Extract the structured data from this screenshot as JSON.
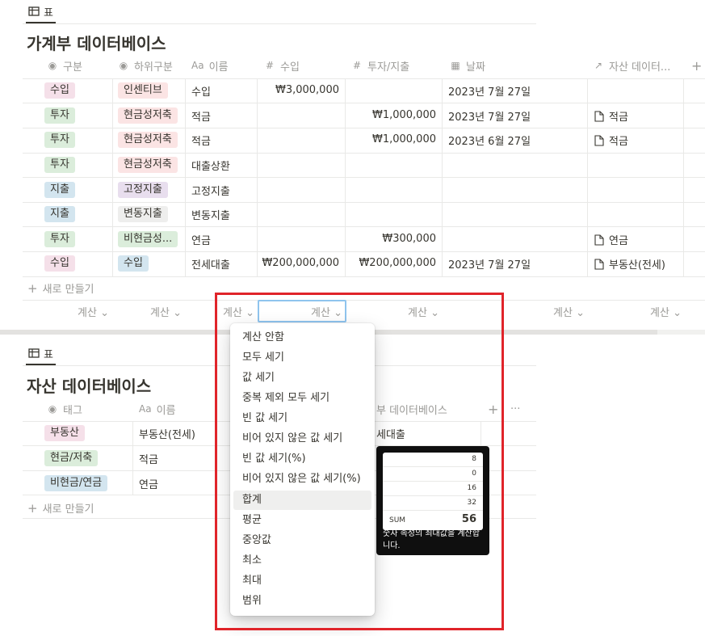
{
  "table1": {
    "tab_label": "표",
    "title": "가계부 데이터베이스",
    "headers": {
      "type": "구분",
      "subtype": "하위구분",
      "name": "이름",
      "income": "수입",
      "invest": "투자/지출",
      "date": "날짜",
      "asset": "자산 데이터...",
      "add": "+"
    },
    "header_icons": {
      "type": "◉",
      "subtype": "◉",
      "name": "Aa",
      "income": "#",
      "invest": "#",
      "date": "▦",
      "asset": "↗"
    },
    "rows": [
      {
        "type": "수입",
        "subtype": "인센티브",
        "name": "수입",
        "income": "₩3,000,000",
        "invest": "",
        "date": "2023년 7월 27일",
        "asset": ""
      },
      {
        "type": "투자",
        "subtype": "현금성저축",
        "name": "적금",
        "income": "",
        "invest": "₩1,000,000",
        "date": "2023년 7월 27일",
        "asset": "적금"
      },
      {
        "type": "투자",
        "subtype": "현금성저축",
        "name": "적금",
        "income": "",
        "invest": "₩1,000,000",
        "date": "2023년 6월 27일",
        "asset": "적금"
      },
      {
        "type": "투자",
        "subtype": "현금성저축",
        "name": "대출상환",
        "income": "",
        "invest": "",
        "date": "",
        "asset": ""
      },
      {
        "type": "지출",
        "subtype": "고정지출",
        "name": "고정지출",
        "income": "",
        "invest": "",
        "date": "",
        "asset": ""
      },
      {
        "type": "지출",
        "subtype": "변동지출",
        "name": "변동지출",
        "income": "",
        "invest": "",
        "date": "",
        "asset": ""
      },
      {
        "type": "투자",
        "subtype": "비현금성...",
        "name": "연금",
        "income": "",
        "invest": "₩300,000",
        "date": "",
        "asset": "연금"
      },
      {
        "type": "수입",
        "subtype": "수입",
        "name": "전세대출",
        "income": "₩200,000,000",
        "invest": "₩200,000,000",
        "date": "2023년 7월 27일",
        "asset": "부동산(전세)"
      }
    ],
    "new_row": "새로 만들기",
    "calc_label": "계산"
  },
  "table2": {
    "tab_label": "표",
    "title": "자산 데이터베이스",
    "headers": {
      "tag": "태그",
      "name": "이름",
      "relation": "부 데이터베이스",
      "add": "+",
      "more": "···"
    },
    "header_icons": {
      "tag": "◉",
      "name": "Aa"
    },
    "rows": [
      {
        "tag": "부동산",
        "name": "부동산(전세)",
        "relation": "세대출"
      },
      {
        "tag": "현금/저축",
        "name": "적금",
        "relation": ""
      },
      {
        "tag": "비현금/연금",
        "name": "연금",
        "relation": ""
      }
    ],
    "new_row": "새로 만들기"
  },
  "calc_menu": {
    "items": [
      "계산 안함",
      "모두 세기",
      "값 세기",
      "중복 제외 모두 세기",
      "빈 값 세기",
      "비어 있지 않은 값 세기",
      "빈 값 세기(%)",
      "비어 있지 않은 값 세기(%)",
      "합계",
      "평균",
      "중앙값",
      "최소",
      "최대",
      "범위"
    ],
    "hovered": "합계"
  },
  "tooltip": {
    "values": [
      "8",
      "0",
      "16",
      "32"
    ],
    "sum_label": "SUM",
    "sum_value": "56",
    "description": "숫자 속성의 최대값을 계산합니다."
  },
  "colors": {
    "highlight_border": "#e0242a",
    "active_calc_border": "#8fc4ee"
  }
}
